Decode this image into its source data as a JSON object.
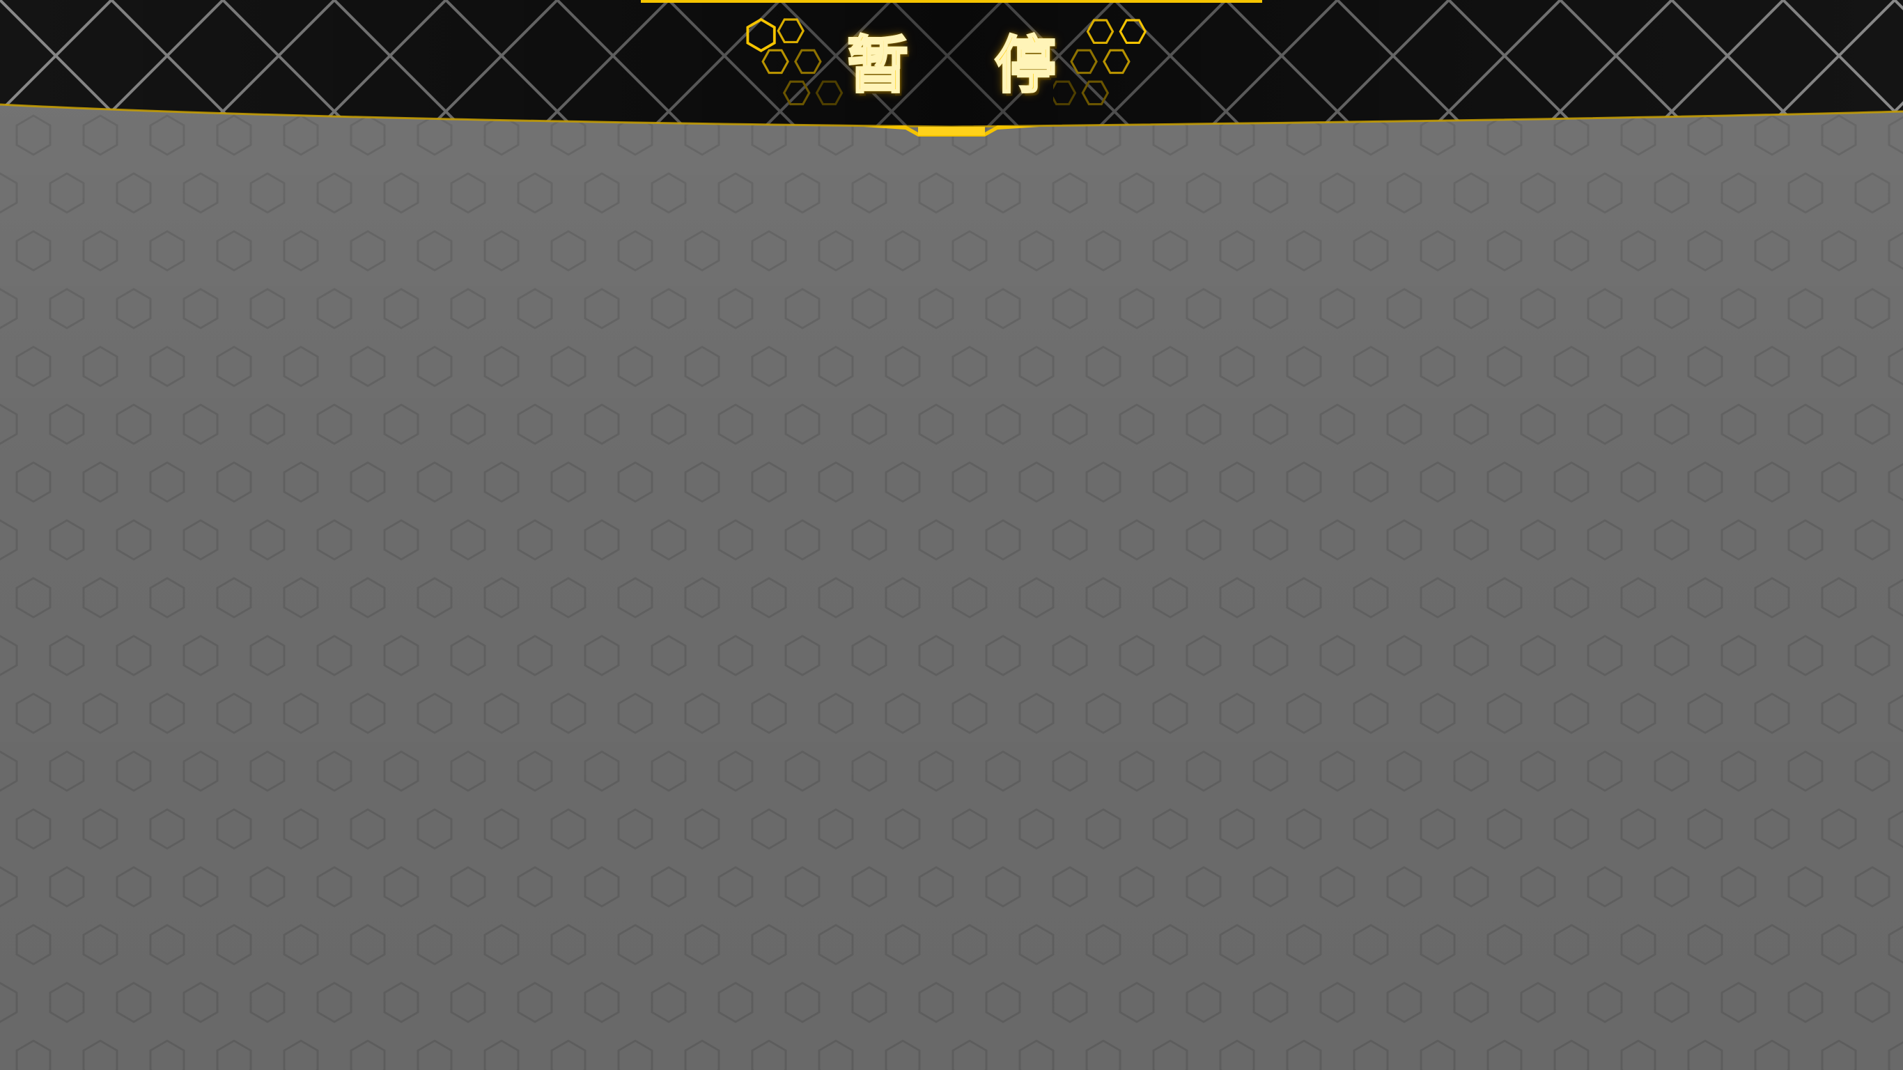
{
  "screen": {
    "name": "pause-screen"
  },
  "title": {
    "char_1": "暂",
    "char_2": "停"
  },
  "colors": {
    "accent": "#f5c400",
    "banner": "#151515",
    "background": "#6c6c6c",
    "hex_pattern": "#626262"
  },
  "icons": {
    "left_cluster": "honeycomb-icon",
    "right_cluster": "honeycomb-icon"
  }
}
